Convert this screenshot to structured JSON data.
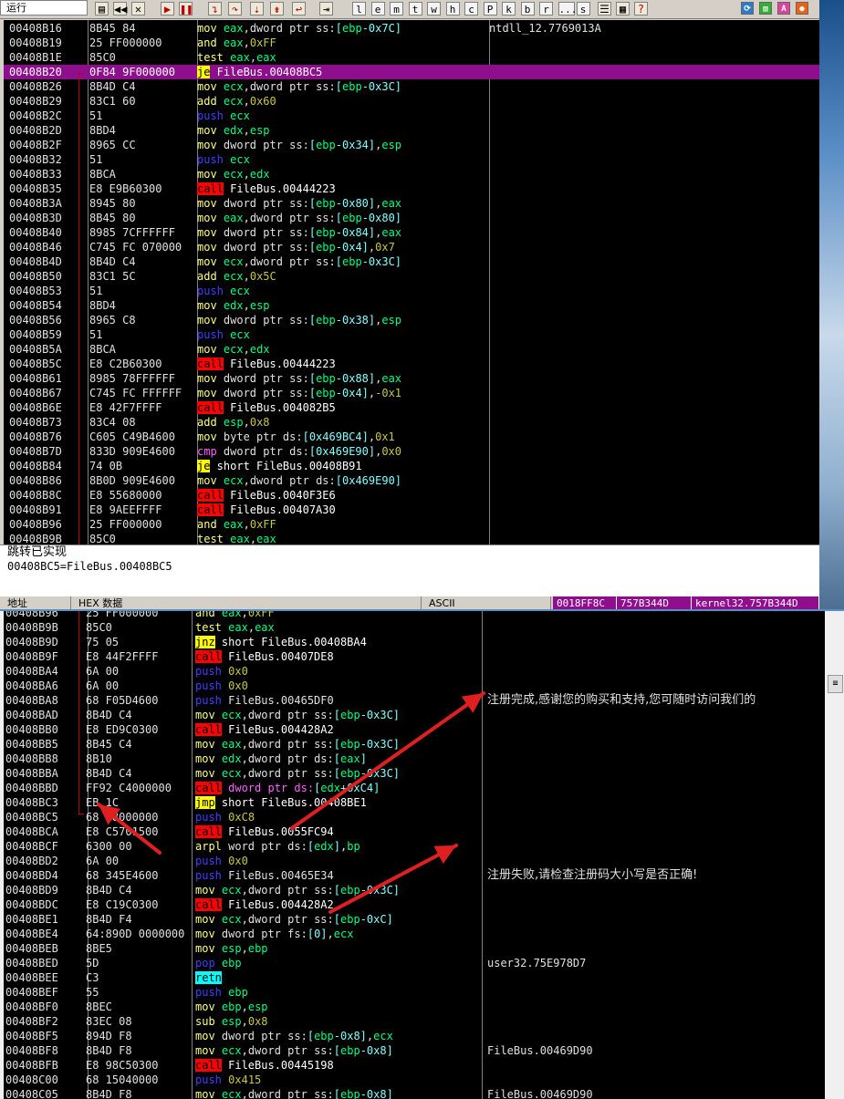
{
  "toolbar": {
    "status": "运行",
    "letters": [
      "l",
      "e",
      "m",
      "t",
      "w",
      "h",
      "c",
      "P",
      "k",
      "b",
      "r",
      "...",
      "s"
    ]
  },
  "top_rows": [
    {
      "addr": "00408B16",
      "hex": "8B45 84",
      "op": "mov",
      "args": "eax,dword ptr ss:[ebp-0x7C]",
      "cmt": "ntdll_12.7769013A"
    },
    {
      "addr": "00408B19",
      "hex": "25 FF000000",
      "op": "and",
      "args": "eax,0xFF",
      "cmt": ""
    },
    {
      "addr": "00408B1E",
      "hex": "85C0",
      "op": "test",
      "args": "eax,eax",
      "cmt": ""
    },
    {
      "addr": "00408B20",
      "hex": "0F84 9F000000",
      "op": "je",
      "args": "FileBus.00408BC5",
      "cmt": "",
      "sel": true
    },
    {
      "addr": "00408B26",
      "hex": "8B4D C4",
      "op": "mov",
      "args": "ecx,dword ptr ss:[ebp-0x3C]",
      "cmt": ""
    },
    {
      "addr": "00408B29",
      "hex": "83C1 60",
      "op": "add",
      "args": "ecx,0x60",
      "cmt": ""
    },
    {
      "addr": "00408B2C",
      "hex": "51",
      "op": "push",
      "args": "ecx",
      "cmt": ""
    },
    {
      "addr": "00408B2D",
      "hex": "8BD4",
      "op": "mov",
      "args": "edx,esp",
      "cmt": ""
    },
    {
      "addr": "00408B2F",
      "hex": "8965 CC",
      "op": "mov",
      "args": "dword ptr ss:[ebp-0x34],esp",
      "cmt": ""
    },
    {
      "addr": "00408B32",
      "hex": "51",
      "op": "push",
      "args": "ecx",
      "cmt": ""
    },
    {
      "addr": "00408B33",
      "hex": "8BCA",
      "op": "mov",
      "args": "ecx,edx",
      "cmt": ""
    },
    {
      "addr": "00408B35",
      "hex": "E8 E9B60300",
      "op": "call",
      "args": "FileBus.00444223",
      "cmt": ""
    },
    {
      "addr": "00408B3A",
      "hex": "8945 80",
      "op": "mov",
      "args": "dword ptr ss:[ebp-0x80],eax",
      "cmt": ""
    },
    {
      "addr": "00408B3D",
      "hex": "8B45 80",
      "op": "mov",
      "args": "eax,dword ptr ss:[ebp-0x80]",
      "cmt": ""
    },
    {
      "addr": "00408B40",
      "hex": "8985 7CFFFFFF",
      "op": "mov",
      "args": "dword ptr ss:[ebp-0x84],eax",
      "cmt": ""
    },
    {
      "addr": "00408B46",
      "hex": "C745 FC 070000",
      "op": "mov",
      "args": "dword ptr ss:[ebp-0x4],0x7",
      "cmt": ""
    },
    {
      "addr": "00408B4D",
      "hex": "8B4D C4",
      "op": "mov",
      "args": "ecx,dword ptr ss:[ebp-0x3C]",
      "cmt": ""
    },
    {
      "addr": "00408B50",
      "hex": "83C1 5C",
      "op": "add",
      "args": "ecx,0x5C",
      "cmt": ""
    },
    {
      "addr": "00408B53",
      "hex": "51",
      "op": "push",
      "args": "ecx",
      "cmt": ""
    },
    {
      "addr": "00408B54",
      "hex": "8BD4",
      "op": "mov",
      "args": "edx,esp",
      "cmt": ""
    },
    {
      "addr": "00408B56",
      "hex": "8965 C8",
      "op": "mov",
      "args": "dword ptr ss:[ebp-0x38],esp",
      "cmt": ""
    },
    {
      "addr": "00408B59",
      "hex": "51",
      "op": "push",
      "args": "ecx",
      "cmt": ""
    },
    {
      "addr": "00408B5A",
      "hex": "8BCA",
      "op": "mov",
      "args": "ecx,edx",
      "cmt": ""
    },
    {
      "addr": "00408B5C",
      "hex": "E8 C2B60300",
      "op": "call",
      "args": "FileBus.00444223",
      "cmt": ""
    },
    {
      "addr": "00408B61",
      "hex": "8985 78FFFFFF",
      "op": "mov",
      "args": "dword ptr ss:[ebp-0x88],eax",
      "cmt": ""
    },
    {
      "addr": "00408B67",
      "hex": "C745 FC FFFFFF",
      "op": "mov",
      "args": "dword ptr ss:[ebp-0x4],-0x1",
      "cmt": ""
    },
    {
      "addr": "00408B6E",
      "hex": "E8 42F7FFFF",
      "op": "call",
      "args": "FileBus.004082B5",
      "cmt": ""
    },
    {
      "addr": "00408B73",
      "hex": "83C4 08",
      "op": "add",
      "args": "esp,0x8",
      "cmt": ""
    },
    {
      "addr": "00408B76",
      "hex": "C605 C49B4600",
      "op": "mov",
      "args": "byte ptr ds:[0x469BC4],0x1",
      "cmt": ""
    },
    {
      "addr": "00408B7D",
      "hex": "833D 909E4600",
      "op": "cmp",
      "args": "dword ptr ds:[0x469E90],0x0",
      "cmt": ""
    },
    {
      "addr": "00408B84",
      "hex": "74 0B",
      "op": "je",
      "args": "short FileBus.00408B91",
      "cmt": ""
    },
    {
      "addr": "00408B86",
      "hex": "8B0D 909E4600",
      "op": "mov",
      "args": "ecx,dword ptr ds:[0x469E90]",
      "cmt": ""
    },
    {
      "addr": "00408B8C",
      "hex": "E8 55680000",
      "op": "call",
      "args": "FileBus.0040F3E6",
      "cmt": ""
    },
    {
      "addr": "00408B91",
      "hex": "E8 9AEEFFFF",
      "op": "call",
      "args": "FileBus.00407A30",
      "cmt": ""
    },
    {
      "addr": "00408B96",
      "hex": "25 FF000000",
      "op": "and",
      "args": "eax,0xFF",
      "cmt": ""
    },
    {
      "addr": "00408B9B",
      "hex": "85C0",
      "op": "test",
      "args": "eax,eax",
      "cmt": ""
    }
  ],
  "info": {
    "line1": "跳转已实现",
    "line2": "00408BC5=FileBus.00408BC5"
  },
  "dump_header": {
    "addr": "地址",
    "hex": "HEX 数据",
    "ascii": "ASCII",
    "stack1": "0018FF8C",
    "stack2": "757B344D",
    "stack3": "kernel32.757B344D"
  },
  "bot_rows": [
    {
      "addr": "00408B96",
      "hex": "25 FF000000",
      "op": "and",
      "args": "eax,0xFF",
      "cmt": ""
    },
    {
      "addr": "00408B9B",
      "hex": "85C0",
      "op": "test",
      "args": "eax,eax",
      "cmt": ""
    },
    {
      "addr": "00408B9D",
      "hex": "75 05",
      "op": "jnz",
      "args": "short FileBus.00408BA4",
      "cmt": ""
    },
    {
      "addr": "00408B9F",
      "hex": "E8 44F2FFFF",
      "op": "call",
      "args": "FileBus.00407DE8",
      "cmt": ""
    },
    {
      "addr": "00408BA4",
      "hex": "6A 00",
      "op": "push",
      "args": "0x0",
      "cmt": ""
    },
    {
      "addr": "00408BA6",
      "hex": "6A 00",
      "op": "push",
      "args": "0x0",
      "cmt": ""
    },
    {
      "addr": "00408BA8",
      "hex": "68 F05D4600",
      "op": "push",
      "args": "FileBus.00465DF0",
      "cmt": "注册完成,感谢您的购买和支持,您可随时访问我们的"
    },
    {
      "addr": "00408BAD",
      "hex": "8B4D C4",
      "op": "mov",
      "args": "ecx,dword ptr ss:[ebp-0x3C]",
      "cmt": ""
    },
    {
      "addr": "00408BB0",
      "hex": "E8 ED9C0300",
      "op": "call",
      "args": "FileBus.004428A2",
      "cmt": ""
    },
    {
      "addr": "00408BB5",
      "hex": "8B45 C4",
      "op": "mov",
      "args": "eax,dword ptr ss:[ebp-0x3C]",
      "cmt": ""
    },
    {
      "addr": "00408BB8",
      "hex": "8B10",
      "op": "mov",
      "args": "edx,dword ptr ds:[eax]",
      "cmt": ""
    },
    {
      "addr": "00408BBA",
      "hex": "8B4D C4",
      "op": "mov",
      "args": "ecx,dword ptr ss:[ebp-0x3C]",
      "cmt": ""
    },
    {
      "addr": "00408BBD",
      "hex": "FF92 C4000000",
      "op": "call",
      "args": "dword ptr ds:[edx+0xC4]",
      "cmt": ""
    },
    {
      "addr": "00408BC3",
      "hex": "EB 1C",
      "op": "jmp",
      "args": "short FileBus.00408BE1",
      "cmt": ""
    },
    {
      "addr": "00408BC5",
      "hex": "68 C8000000",
      "op": "push",
      "args": "0xC8",
      "cmt": ""
    },
    {
      "addr": "00408BCA",
      "hex": "E8 C5701500",
      "op": "call",
      "args": "FileBus.0055FC94",
      "cmt": ""
    },
    {
      "addr": "00408BCF",
      "hex": "6300 00",
      "op": "arpl",
      "args": "word ptr ds:[edx],bp",
      "cmt": ""
    },
    {
      "addr": "00408BD2",
      "hex": "6A 00",
      "op": "push",
      "args": "0x0",
      "cmt": ""
    },
    {
      "addr": "00408BD4",
      "hex": "68 345E4600",
      "op": "push",
      "args": "FileBus.00465E34",
      "cmt": "注册失败,请检查注册码大小写是否正确!"
    },
    {
      "addr": "00408BD9",
      "hex": "8B4D C4",
      "op": "mov",
      "args": "ecx,dword ptr ss:[ebp-0x3C]",
      "cmt": ""
    },
    {
      "addr": "00408BDC",
      "hex": "E8 C19C0300",
      "op": "call",
      "args": "FileBus.004428A2",
      "cmt": ""
    },
    {
      "addr": "00408BE1",
      "hex": "8B4D F4",
      "op": "mov",
      "args": "ecx,dword ptr ss:[ebp-0xC]",
      "cmt": ""
    },
    {
      "addr": "00408BE4",
      "hex": "64:890D 0000000",
      "op": "mov",
      "args": "dword ptr fs:[0],ecx",
      "cmt": ""
    },
    {
      "addr": "00408BEB",
      "hex": "8BE5",
      "op": "mov",
      "args": "esp,ebp",
      "cmt": ""
    },
    {
      "addr": "00408BED",
      "hex": "5D",
      "op": "pop",
      "args": "ebp",
      "cmt": "user32.75E978D7"
    },
    {
      "addr": "00408BEE",
      "hex": "C3",
      "op": "retn",
      "args": "",
      "cmt": ""
    },
    {
      "addr": "00408BEF",
      "hex": "55",
      "op": "push",
      "args": "ebp",
      "cmt": ""
    },
    {
      "addr": "00408BF0",
      "hex": "8BEC",
      "op": "mov",
      "args": "ebp,esp",
      "cmt": ""
    },
    {
      "addr": "00408BF2",
      "hex": "83EC 08",
      "op": "sub",
      "args": "esp,0x8",
      "cmt": ""
    },
    {
      "addr": "00408BF5",
      "hex": "894D F8",
      "op": "mov",
      "args": "dword ptr ss:[ebp-0x8],ecx",
      "cmt": ""
    },
    {
      "addr": "00408BF8",
      "hex": "8B4D F8",
      "op": "mov",
      "args": "ecx,dword ptr ss:[ebp-0x8]",
      "cmt": "FileBus.00469D90"
    },
    {
      "addr": "00408BFB",
      "hex": "E8 98C50300",
      "op": "call",
      "args": "FileBus.00445198",
      "cmt": ""
    },
    {
      "addr": "00408C00",
      "hex": "68 15040000",
      "op": "push",
      "args": "0x415",
      "cmt": ""
    },
    {
      "addr": "00408C05",
      "hex": "8B4D F8",
      "op": "mov",
      "args": "ecx,dword ptr ss:[ebp-0x8]",
      "cmt": "FileBus.00469D90"
    }
  ],
  "colors": {
    "selection": "#8E0E8E",
    "call_bg": "#FF0000",
    "jump_bg": "#FFFF00",
    "retn_bg": "#00FFFF",
    "arrow": "#E02020"
  }
}
